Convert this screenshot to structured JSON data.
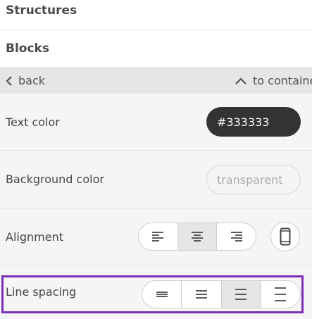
{
  "sections": {
    "structures": "Structures",
    "blocks": "Blocks"
  },
  "nav": {
    "back_label": "back",
    "to_container_label": "to containe"
  },
  "rows": {
    "text_color": {
      "label": "Text color",
      "value": "#333333"
    },
    "background_color": {
      "label": "Background color",
      "value": "transparent"
    },
    "alignment": {
      "label": "Alignment",
      "options": [
        "align-left-icon",
        "align-center-icon",
        "align-right-icon"
      ],
      "selected": "align-center-icon",
      "device_toggle_icon": "mobile-phone-icon"
    },
    "line_spacing": {
      "label": "Line spacing",
      "options": [
        "line-spacing-tight-icon",
        "line-spacing-normal-icon",
        "line-spacing-medium-icon",
        "line-spacing-wide-icon"
      ],
      "selected": "line-spacing-medium-icon"
    }
  },
  "colors": {
    "highlight": "#7b2fb4",
    "dark_pill": "#333333",
    "active_segment": "#e6e6e6",
    "nav_bar": "#e6e6e6"
  }
}
